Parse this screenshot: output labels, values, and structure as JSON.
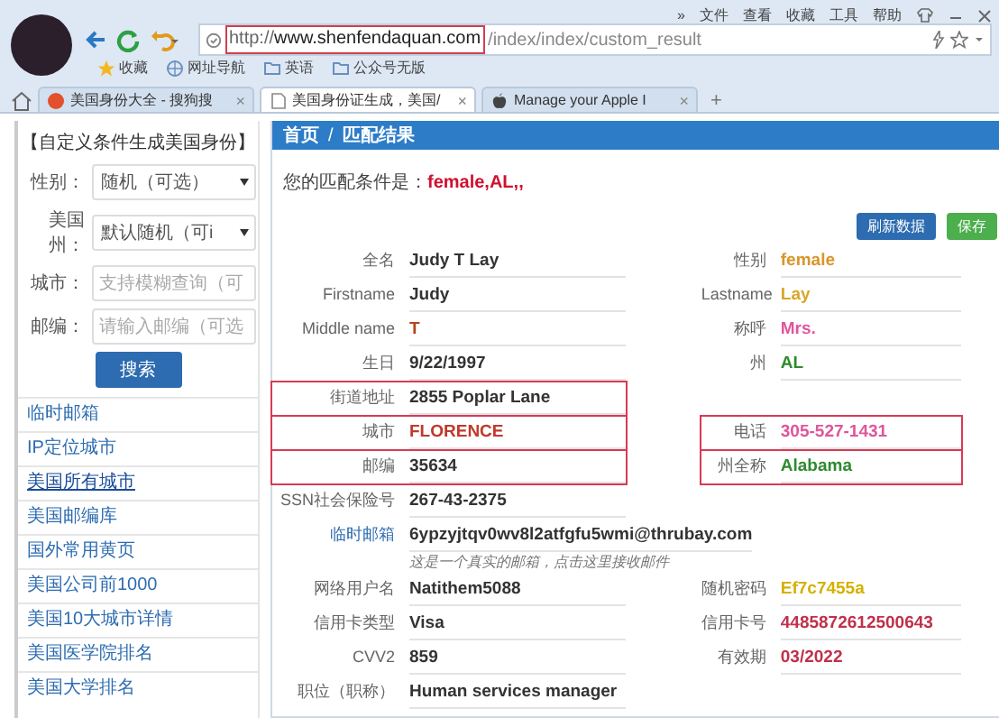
{
  "browser": {
    "menu": [
      "»",
      "文件",
      "查看",
      "收藏",
      "工具",
      "帮助"
    ],
    "address": {
      "host": "http://www.shenfendaquan.com",
      "path": "/index/index/custom_result",
      "highlighted": true
    },
    "bookmarks": [
      "收藏",
      "网址导航",
      "英语",
      "公众号无版"
    ],
    "tabs": [
      {
        "label": "美国身份大全 - 搜狗搜",
        "selected": false,
        "close": "×"
      },
      {
        "label": "美国身份证生成，美国/",
        "selected": true,
        "close": "×"
      },
      {
        "label": "Manage your Apple I",
        "selected": false,
        "close": "×"
      }
    ],
    "new_tab": "+"
  },
  "sidebar": {
    "title": "【自定义条件生成美国身份】",
    "form": [
      {
        "label": "性别：",
        "kind": "select",
        "value": "随机（可选）"
      },
      {
        "label": "美国州：",
        "kind": "select",
        "value": "默认随机（可i"
      },
      {
        "label": "城市：",
        "kind": "input",
        "placeholder": "支持模糊查询（可"
      },
      {
        "label": "邮编：",
        "kind": "input",
        "placeholder": "请输入邮编（可选"
      }
    ],
    "search_button": "搜索",
    "items": [
      {
        "label": "临时邮箱",
        "selected": false
      },
      {
        "label": "IP定位城市",
        "selected": false
      },
      {
        "label": "美国所有城市",
        "selected": true
      },
      {
        "label": "美国邮编库",
        "selected": false
      },
      {
        "label": "国外常用黄页",
        "selected": false
      },
      {
        "label": "美国公司前1000",
        "selected": false
      },
      {
        "label": "美国10大城市详情",
        "selected": false
      },
      {
        "label": "美国医学院排名",
        "selected": false
      },
      {
        "label": "美国大学排名",
        "selected": false
      }
    ]
  },
  "main": {
    "breadcrumb": [
      "首页",
      "/",
      "匹配结果"
    ],
    "criteria_label": "您的匹配条件是：",
    "criteria": "female,AL,,",
    "buttons": [
      {
        "label": "刷新数据",
        "kind": "primary"
      },
      {
        "label": "保存",
        "kind": "success"
      }
    ],
    "rows": [
      {
        "kind": "pair",
        "left": {
          "label": "全名",
          "value": "Judy T Lay",
          "color": "#333333",
          "highlighted": false
        },
        "right": {
          "label": "性别",
          "value": "female",
          "color": "#d9962a",
          "highlighted": false
        }
      },
      {
        "kind": "pair",
        "left": {
          "label": "Firstname",
          "value": "Judy",
          "color": "#333333",
          "highlighted": false
        },
        "right": {
          "label": "Lastname",
          "value": "Lay",
          "color": "#d9a62a",
          "highlighted": false
        }
      },
      {
        "kind": "pair",
        "left": {
          "label": "Middle name",
          "value": "T",
          "color": "#b5451b",
          "highlighted": false
        },
        "right": {
          "label": "称呼",
          "value": "Mrs.",
          "color": "#e0559b",
          "highlighted": false
        }
      },
      {
        "kind": "pair",
        "left": {
          "label": "生日",
          "value": "9/22/1997",
          "color": "#333333",
          "highlighted": false
        },
        "right": {
          "label": "州",
          "value": "AL",
          "color": "#2e8b2e",
          "highlighted": false
        }
      },
      {
        "kind": "pair",
        "left": {
          "label": "街道地址",
          "value": "2855 Poplar Lane",
          "color": "#333333",
          "highlighted": true
        }
      },
      {
        "kind": "pair",
        "left": {
          "label": "城市",
          "value": "FLORENCE",
          "color": "#c0392b",
          "highlighted": true
        },
        "right": {
          "label": "电话",
          "value": "305-527-1431",
          "color": "#e0559b",
          "highlighted": true
        }
      },
      {
        "kind": "pair",
        "left": {
          "label": "邮编",
          "value": "35634",
          "color": "#333333",
          "highlighted": true
        },
        "right": {
          "label": "州全称",
          "value": "Alabama",
          "color": "#2e8b2e",
          "highlighted": true
        }
      },
      {
        "kind": "pair",
        "left": {
          "label": "SSN社会保险号",
          "value": "267-43-2375",
          "color": "#333333",
          "highlighted": false
        }
      },
      {
        "kind": "email",
        "left": {
          "label": "临时邮箱",
          "value": "6ypzyjtqv0wv8l2atfgfu5wmi@thrubay.com",
          "note": "这是一个真实的邮箱，点击这里接收邮件",
          "color": "#333333",
          "highlighted": false
        }
      },
      {
        "kind": "pair",
        "left": {
          "label": "网络用户名",
          "value": "Natithem5088",
          "color": "#333333",
          "highlighted": false
        },
        "right": {
          "label": "随机密码",
          "value": "Ef7c7455a",
          "color": "#d4b000",
          "highlighted": false
        }
      },
      {
        "kind": "pair",
        "left": {
          "label": "信用卡类型",
          "value": "Visa",
          "color": "#333333",
          "highlighted": false
        },
        "right": {
          "label": "信用卡号",
          "value": "4485872612500643",
          "color": "#c0304a",
          "highlighted": false
        }
      },
      {
        "kind": "pair",
        "left": {
          "label": "CVV2",
          "value": "859",
          "color": "#333333",
          "highlighted": false
        },
        "right": {
          "label": "有效期",
          "value": "03/2022",
          "color": "#c0304a",
          "highlighted": false
        }
      },
      {
        "kind": "pair",
        "left": {
          "label": "职位（职称）",
          "value": "Human services manager",
          "color": "#333333",
          "highlighted": false
        }
      }
    ]
  }
}
